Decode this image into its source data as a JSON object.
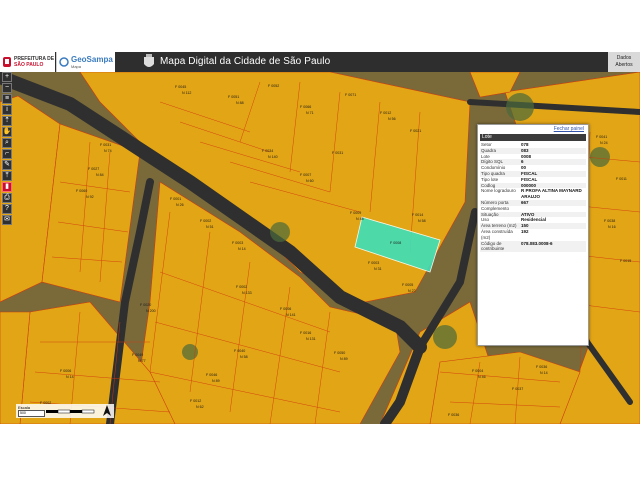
{
  "header": {
    "logo_sp_line1": "PREFEITURA DE",
    "logo_sp_line2": "SÃO PAULO",
    "logo_geo": "GeoSampa",
    "logo_geo_sub": "Mapa",
    "title": "Mapa Digital da Cidade de São Paulo",
    "user_line1": "Dados",
    "user_line2": "Abertos"
  },
  "toolbar": {
    "items": [
      {
        "icon": "zoom-in-icon",
        "glyph": "+"
      },
      {
        "icon": "zoom-out-icon",
        "glyph": "−"
      },
      {
        "icon": "layers-icon",
        "glyph": "≡"
      },
      {
        "icon": "info-icon",
        "glyph": "i"
      },
      {
        "icon": "navigate-icon",
        "glyph": "⇡"
      },
      {
        "icon": "pan-icon",
        "glyph": "✋"
      },
      {
        "icon": "search-icon",
        "glyph": "⌕"
      },
      {
        "icon": "measure-icon",
        "glyph": "⌐"
      },
      {
        "icon": "draw-icon",
        "glyph": "✎"
      },
      {
        "icon": "upload-icon",
        "glyph": "⤒"
      },
      {
        "icon": "bookmark-icon",
        "glyph": "▮"
      },
      {
        "icon": "print-icon",
        "glyph": "⎙"
      },
      {
        "icon": "help-icon",
        "glyph": "?"
      },
      {
        "icon": "mail-icon",
        "glyph": "✉"
      }
    ]
  },
  "popup": {
    "close_label": "Fechar painel",
    "header": "Lote",
    "rows": [
      {
        "key": "Setor",
        "value": "078"
      },
      {
        "key": "Quadra",
        "value": "083"
      },
      {
        "key": "Lote",
        "value": "0008"
      },
      {
        "key": "Dígito SQL",
        "value": "6"
      },
      {
        "key": "Condomínio",
        "value": "00"
      },
      {
        "key": "Tipo quadra",
        "value": "FISCAL"
      },
      {
        "key": "Tipo lote",
        "value": "FISCAL"
      },
      {
        "key": "Codlog",
        "value": "000000"
      },
      {
        "key": "Nome logradouro",
        "value": "R PROFA ALTINA MAYNARD ARAUJO"
      },
      {
        "key": "Número porta",
        "value": "667"
      },
      {
        "key": "Complemento",
        "value": ""
      },
      {
        "key": "Situação",
        "value": "ATIVO"
      },
      {
        "key": "Uso",
        "value": "Residencial"
      },
      {
        "key": "Área terreno (m2)",
        "value": "150"
      },
      {
        "key": "Área construída (m2)",
        "value": "192"
      },
      {
        "key": "Código de contribuinte",
        "value": "078.083.0008-6"
      }
    ]
  },
  "scale": {
    "label": "Escala",
    "value": "500",
    "north": "N"
  },
  "colors": {
    "lot_fill": "#e8a915",
    "lot_stroke": "#d23a0c",
    "selected_lot": "#3ee0b8",
    "road": "#3a3a3a",
    "header_bg": "#2e2e2e"
  }
}
